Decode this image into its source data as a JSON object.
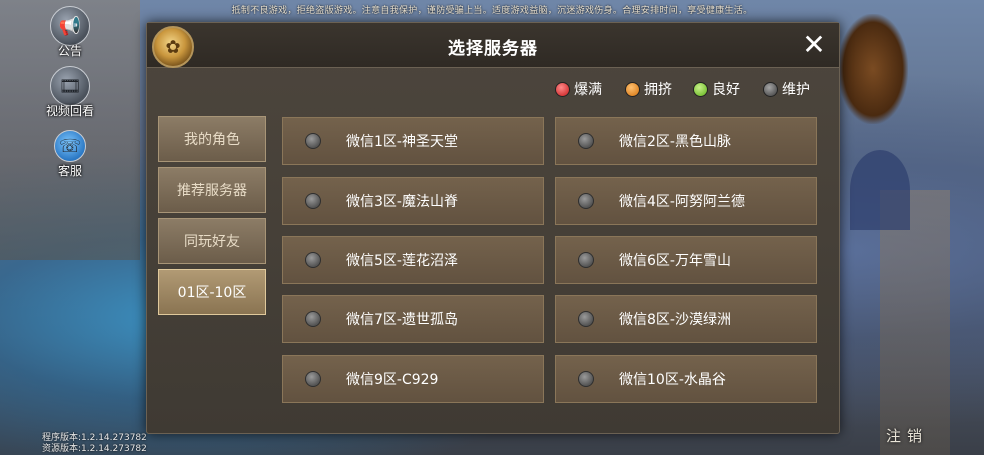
{
  "background": {
    "notice": "抵制不良游戏，拒绝盗版游戏。注意自我保护，谨防受骗上当。适度游戏益脑，沉迷游戏伤身。合理安排时间，享受健康生活。",
    "side_buttons": [
      {
        "label": "公告",
        "icon": "megaphone-icon"
      },
      {
        "label": "视频回看",
        "icon": "film-reel-icon"
      },
      {
        "label": "客服",
        "icon": "headset-icon"
      }
    ],
    "program_version": "程序版本:1.2.14.273782",
    "resource_version": "资源版本:1.2.14.273782",
    "logout_label": "注销",
    "emblem": "game-emblem-icon"
  },
  "dialog": {
    "title": "选择服务器",
    "close_icon": "close-icon",
    "legend": [
      {
        "label": "爆满",
        "color": "#d63a3a"
      },
      {
        "label": "拥挤",
        "color": "#e0892a"
      },
      {
        "label": "良好",
        "color": "#7ec43a"
      },
      {
        "label": "维护",
        "color": "#6a6a6a"
      }
    ],
    "tabs": [
      {
        "label": "我的角色",
        "active": false
      },
      {
        "label": "推荐服务器",
        "active": false
      },
      {
        "label": "同玩好友",
        "active": false
      },
      {
        "label": "01区-10区",
        "active": true
      }
    ],
    "servers": [
      {
        "name": "微信1区-神圣天堂",
        "status": "维护"
      },
      {
        "name": "微信2区-黑色山脉",
        "status": "维护"
      },
      {
        "name": "微信3区-魔法山脊",
        "status": "维护"
      },
      {
        "name": "微信4区-阿努阿兰德",
        "status": "维护"
      },
      {
        "name": "微信5区-莲花沼泽",
        "status": "维护"
      },
      {
        "name": "微信6区-万年雪山",
        "status": "维护"
      },
      {
        "name": "微信7区-遗世孤岛",
        "status": "维护"
      },
      {
        "name": "微信8区-沙漠绿洲",
        "status": "维护"
      },
      {
        "name": "微信9区-C929",
        "status": "维护"
      },
      {
        "name": "微信10区-水晶谷",
        "status": "维护"
      }
    ]
  }
}
